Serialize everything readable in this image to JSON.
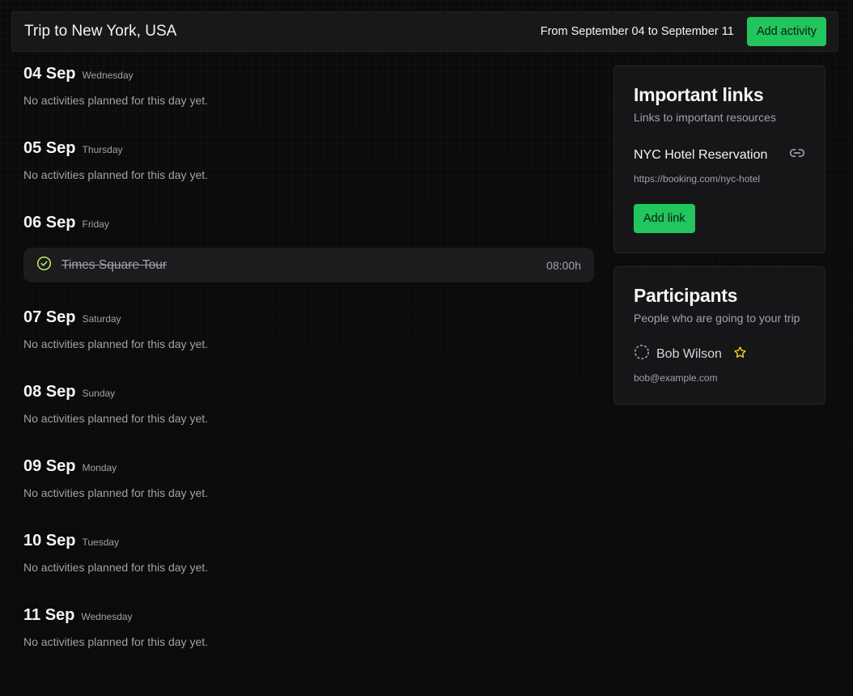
{
  "header": {
    "title": "Trip to New York, USA",
    "date_range": "From September 04 to September 11",
    "add_activity_label": "Add activity"
  },
  "days": [
    {
      "date": "04 Sep",
      "weekday": "Wednesday",
      "empty": "No activities planned for this day yet."
    },
    {
      "date": "05 Sep",
      "weekday": "Thursday",
      "empty": "No activities planned for this day yet."
    },
    {
      "date": "06 Sep",
      "weekday": "Friday",
      "activity": {
        "name": "Times Square Tour",
        "time": "08:00h",
        "done": true
      }
    },
    {
      "date": "07 Sep",
      "weekday": "Saturday",
      "empty": "No activities planned for this day yet."
    },
    {
      "date": "08 Sep",
      "weekday": "Sunday",
      "empty": "No activities planned for this day yet."
    },
    {
      "date": "09 Sep",
      "weekday": "Monday",
      "empty": "No activities planned for this day yet."
    },
    {
      "date": "10 Sep",
      "weekday": "Tuesday",
      "empty": "No activities planned for this day yet."
    },
    {
      "date": "11 Sep",
      "weekday": "Wednesday",
      "empty": "No activities planned for this day yet."
    }
  ],
  "links": {
    "title": "Important links",
    "subtitle": "Links to important resources",
    "items": [
      {
        "name": "NYC Hotel Reservation",
        "url": "https://booking.com/nyc-hotel",
        "icon": "link-icon"
      }
    ],
    "add_label": "Add link"
  },
  "participants": {
    "title": "Participants",
    "subtitle": "People who are going to your trip",
    "items": [
      {
        "name": "Bob Wilson",
        "email": "bob@example.com",
        "status_icon": "pending-circle-icon",
        "role_icon": "star-icon"
      }
    ]
  },
  "colors": {
    "accent": "#22c55e",
    "star": "#facc15",
    "check": "#bef264"
  }
}
